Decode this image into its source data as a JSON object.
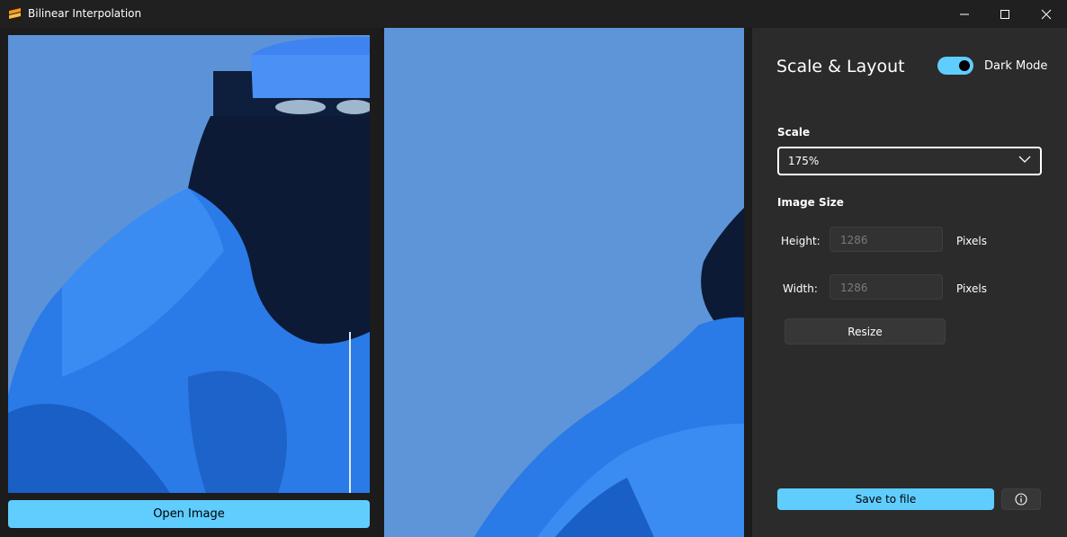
{
  "window": {
    "title": "Bilinear Interpolation",
    "icon": "app-logo-icon",
    "controls": [
      "minimize-icon",
      "maximize-icon",
      "close-icon"
    ]
  },
  "left_panel": {
    "open_button_label": "Open Image"
  },
  "settings": {
    "title": "Scale & Layout",
    "dark_mode_label": "Dark Mode",
    "dark_mode_on": true,
    "scale_label": "Scale",
    "scale_value": "175%",
    "image_size_label": "Image Size",
    "height_label": "Height:",
    "height_placeholder": "1286",
    "width_label": "Width:",
    "width_placeholder": "1286",
    "units": "Pixels",
    "resize_label": "Resize",
    "save_label": "Save to file",
    "info_icon": "info-icon"
  },
  "colors": {
    "accent": "#60cdff",
    "background": "#1c1c1c",
    "panel": "#2b2b2b"
  }
}
